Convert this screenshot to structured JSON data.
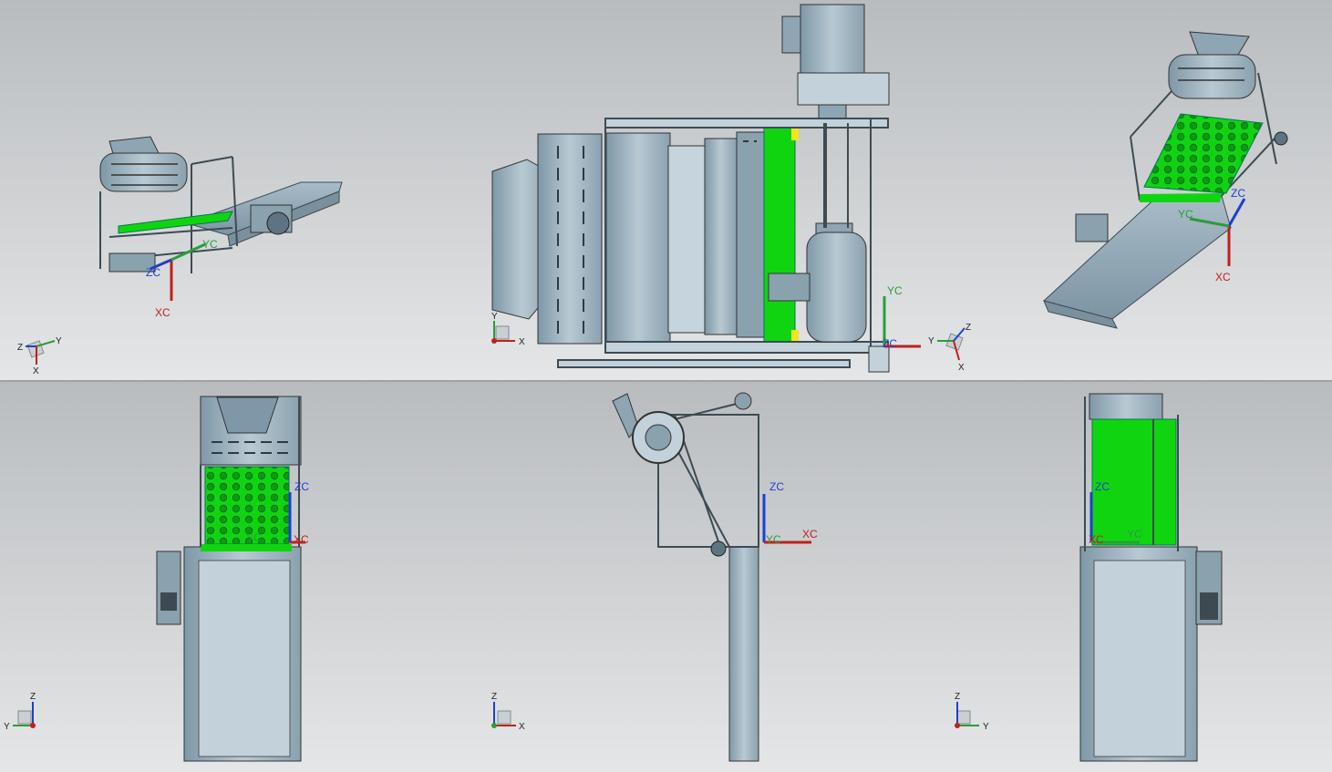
{
  "views": [
    {
      "id": "iso-left",
      "axes": {
        "x": "XC",
        "y": "YC",
        "z": "ZC"
      },
      "triad": {
        "x": "X",
        "y": "Y",
        "z": "Z"
      }
    },
    {
      "id": "top",
      "axes": {
        "x": "XC",
        "y": "YC",
        "z": "ZC"
      },
      "triad": {
        "x": "X",
        "y": "Y"
      }
    },
    {
      "id": "iso-right",
      "axes": {
        "x": "XC",
        "y": "YC",
        "z": "ZC"
      },
      "triad": {
        "x": "X",
        "y": "Y",
        "z": "Z"
      }
    },
    {
      "id": "front",
      "axes": {
        "x": "XC",
        "y": "YC",
        "z": "ZC"
      },
      "triad": {
        "x": "X",
        "y": "Y",
        "z": "Z"
      }
    },
    {
      "id": "side",
      "axes": {
        "x": "XC",
        "y": "YC",
        "z": "ZC"
      },
      "triad": {
        "x": "X",
        "y": "Y",
        "z": "Z"
      }
    },
    {
      "id": "back",
      "axes": {
        "x": "XC",
        "y": "YC",
        "z": "ZC"
      },
      "triad": {
        "x": "X",
        "y": "Y",
        "z": "Z"
      }
    }
  ],
  "colors": {
    "steel": "#9db2bf",
    "steel_dark": "#6d8594",
    "highlight": "#11d411",
    "accent_yellow": "#f2e51b",
    "bg_top": "#b9bcbf",
    "bg_bottom": "#e4e6e7"
  }
}
